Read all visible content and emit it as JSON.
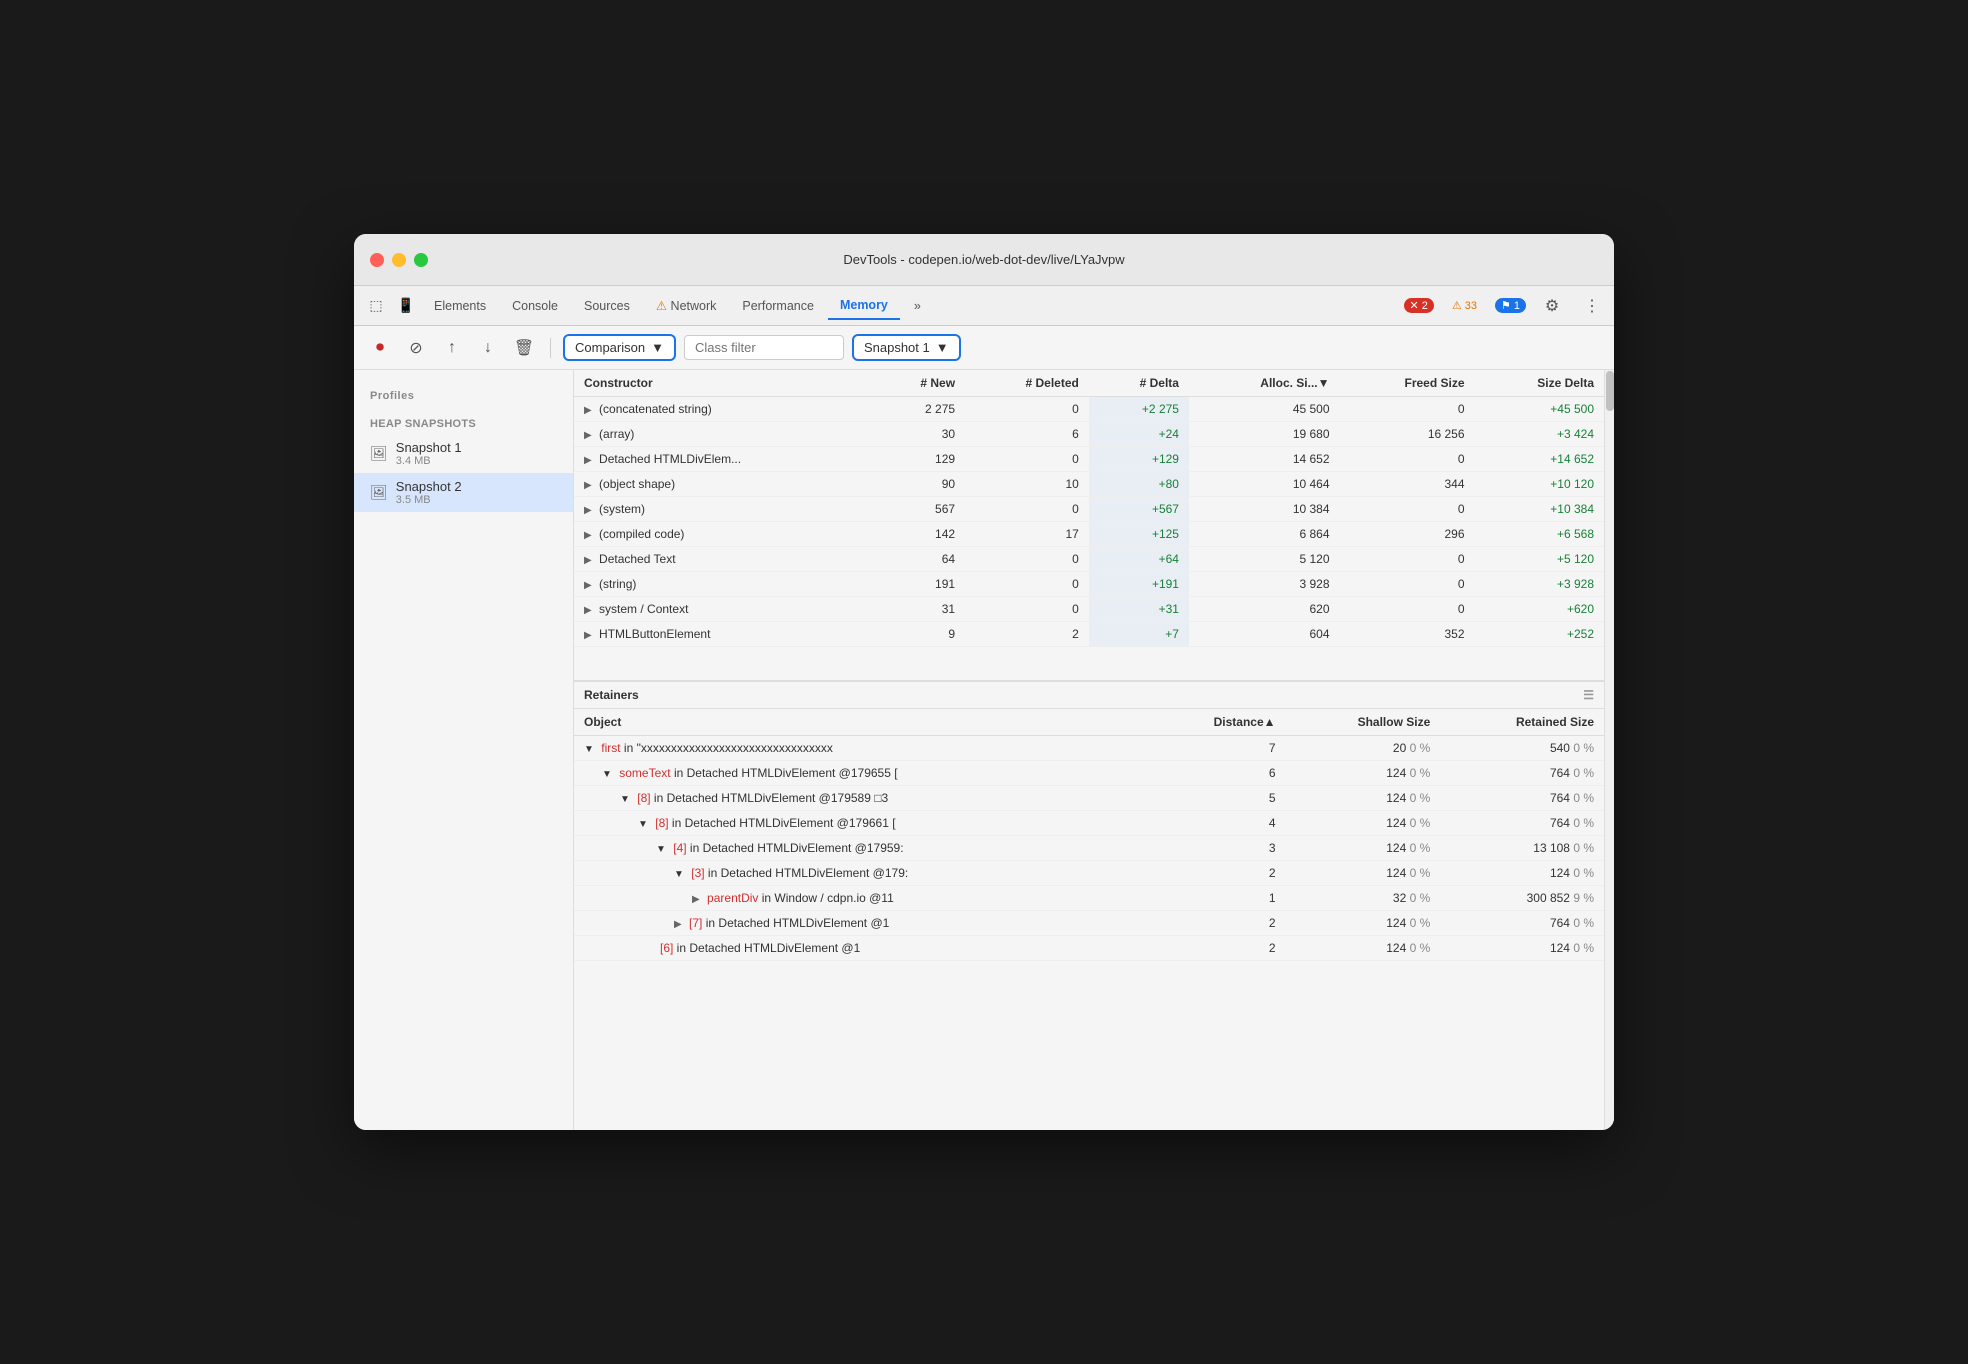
{
  "window": {
    "title": "DevTools - codepen.io/web-dot-dev/live/LYaJvpw"
  },
  "tabs": [
    {
      "label": "Elements",
      "icon": ""
    },
    {
      "label": "Console",
      "icon": ""
    },
    {
      "label": "Sources",
      "icon": ""
    },
    {
      "label": "Network",
      "icon": "⚠"
    },
    {
      "label": "Performance",
      "icon": ""
    },
    {
      "label": "Memory",
      "icon": "",
      "active": true
    },
    {
      "label": "»",
      "icon": ""
    }
  ],
  "badges": {
    "error": "2",
    "warn": "33",
    "info": "1"
  },
  "toolbar": {
    "comparison_label": "Comparison",
    "class_filter_placeholder": "Class filter",
    "snapshot_label": "Snapshot 1"
  },
  "table": {
    "headers": [
      "Constructor",
      "# New",
      "# Deleted",
      "# Delta",
      "Alloc. Si...▼",
      "Freed Size",
      "Size Delta"
    ],
    "rows": [
      {
        "constructor": "(concatenated string)",
        "new": "2 275",
        "deleted": "0",
        "delta": "+2 275",
        "alloc": "45 500",
        "freed": "0",
        "size_delta": "+45 500"
      },
      {
        "constructor": "(array)",
        "new": "30",
        "deleted": "6",
        "delta": "+24",
        "alloc": "19 680",
        "freed": "16 256",
        "size_delta": "+3 424"
      },
      {
        "constructor": "Detached HTMLDivElem...",
        "new": "129",
        "deleted": "0",
        "delta": "+129",
        "alloc": "14 652",
        "freed": "0",
        "size_delta": "+14 652"
      },
      {
        "constructor": "(object shape)",
        "new": "90",
        "deleted": "10",
        "delta": "+80",
        "alloc": "10 464",
        "freed": "344",
        "size_delta": "+10 120"
      },
      {
        "constructor": "(system)",
        "new": "567",
        "deleted": "0",
        "delta": "+567",
        "alloc": "10 384",
        "freed": "0",
        "size_delta": "+10 384"
      },
      {
        "constructor": "(compiled code)",
        "new": "142",
        "deleted": "17",
        "delta": "+125",
        "alloc": "6 864",
        "freed": "296",
        "size_delta": "+6 568"
      },
      {
        "constructor": "Detached Text",
        "new": "64",
        "deleted": "0",
        "delta": "+64",
        "alloc": "5 120",
        "freed": "0",
        "size_delta": "+5 120"
      },
      {
        "constructor": "(string)",
        "new": "191",
        "deleted": "0",
        "delta": "+191",
        "alloc": "3 928",
        "freed": "0",
        "size_delta": "+3 928"
      },
      {
        "constructor": "system / Context",
        "new": "31",
        "deleted": "0",
        "delta": "+31",
        "alloc": "620",
        "freed": "0",
        "size_delta": "+620"
      },
      {
        "constructor": "HTMLButtonElement",
        "new": "9",
        "deleted": "2",
        "delta": "+7",
        "alloc": "604",
        "freed": "352",
        "size_delta": "+252"
      }
    ]
  },
  "retainers": {
    "title": "Retainers",
    "headers": [
      "Object",
      "Distance▲",
      "Shallow Size",
      "Retained Size"
    ],
    "rows": [
      {
        "indent": 0,
        "expand": "▼",
        "object_keyword": "first",
        "object_rest": " in \"xxxxxxxxxxxxxxxxxxxxxxxxxxxxxxxx",
        "distance": "7",
        "shallow": "20",
        "shallow_pct": "0 %",
        "retained": "540",
        "retained_pct": "0 %"
      },
      {
        "indent": 1,
        "expand": "▼",
        "object_keyword": "someText",
        "object_rest": " in Detached HTMLDivElement @179655 [",
        "distance": "6",
        "shallow": "124",
        "shallow_pct": "0 %",
        "retained": "764",
        "retained_pct": "0 %"
      },
      {
        "indent": 2,
        "expand": "▼",
        "object_keyword": "[8]",
        "object_rest": " in Detached HTMLDivElement @179589 □3",
        "distance": "5",
        "shallow": "124",
        "shallow_pct": "0 %",
        "retained": "764",
        "retained_pct": "0 %"
      },
      {
        "indent": 3,
        "expand": "▼",
        "object_keyword": "[8]",
        "object_rest": " in Detached HTMLDivElement @179661 [",
        "distance": "4",
        "shallow": "124",
        "shallow_pct": "0 %",
        "retained": "764",
        "retained_pct": "0 %"
      },
      {
        "indent": 4,
        "expand": "▼",
        "object_keyword": "[4]",
        "object_rest": " in Detached HTMLDivElement @17959:",
        "distance": "3",
        "shallow": "124",
        "shallow_pct": "0 %",
        "retained": "13 108",
        "retained_pct": "0 %"
      },
      {
        "indent": 5,
        "expand": "▼",
        "object_keyword": "[3]",
        "object_rest": " in Detached HTMLDivElement @179:",
        "distance": "2",
        "shallow": "124",
        "shallow_pct": "0 %",
        "retained": "124",
        "retained_pct": "0 %"
      },
      {
        "indent": 6,
        "expand": "▶",
        "object_keyword": "parentDiv",
        "object_rest": " in Window / cdpn.io @11",
        "distance": "1",
        "shallow": "32",
        "shallow_pct": "0 %",
        "retained": "300 852",
        "retained_pct": "9 %"
      },
      {
        "indent": 5,
        "expand": "▶",
        "object_keyword": "[7]",
        "object_rest": " in Detached HTMLDivElement @1",
        "distance": "2",
        "shallow": "124",
        "shallow_pct": "0 %",
        "retained": "764",
        "retained_pct": "0 %"
      },
      {
        "indent": 4,
        "expand": "",
        "object_keyword": "[6]",
        "object_rest": " in Detached HTMLDivElement @1",
        "distance": "2",
        "shallow": "124",
        "shallow_pct": "0 %",
        "retained": "124",
        "retained_pct": "0 %"
      }
    ]
  },
  "sidebar": {
    "profiles_label": "Profiles",
    "heap_snapshots_label": "HEAP SNAPSHOTS",
    "snapshots": [
      {
        "name": "Snapshot 1",
        "size": "3.4 MB"
      },
      {
        "name": "Snapshot 2",
        "size": "3.5 MB",
        "active": true
      }
    ]
  }
}
